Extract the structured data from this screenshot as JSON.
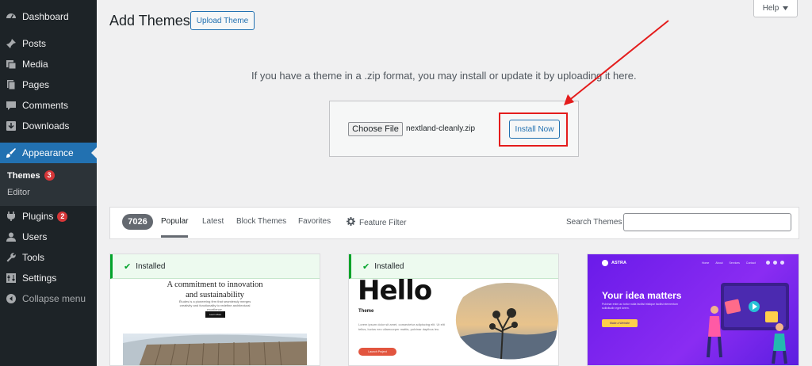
{
  "sidebar": {
    "items": [
      {
        "label": "Dashboard",
        "icon": "dashboard-icon"
      },
      {
        "label": "Posts",
        "icon": "pin-icon"
      },
      {
        "label": "Media",
        "icon": "media-icon"
      },
      {
        "label": "Pages",
        "icon": "pages-icon"
      },
      {
        "label": "Comments",
        "icon": "comment-icon"
      },
      {
        "label": "Downloads",
        "icon": "download-icon"
      },
      {
        "label": "Appearance",
        "icon": "brush-icon"
      },
      {
        "label": "Plugins",
        "icon": "plugin-icon",
        "badge": "2"
      },
      {
        "label": "Users",
        "icon": "users-icon"
      },
      {
        "label": "Tools",
        "icon": "wrench-icon"
      },
      {
        "label": "Settings",
        "icon": "settings-icon"
      },
      {
        "label": "Collapse menu",
        "icon": "collapse-icon"
      }
    ],
    "submenu": [
      {
        "label": "Themes",
        "badge": "3"
      },
      {
        "label": "Editor"
      }
    ]
  },
  "header": {
    "title": "Add Themes",
    "upload_label": "Upload Theme",
    "help_label": "Help"
  },
  "upload": {
    "message": "If you have a theme in a .zip format, you may install or update it by uploading it here.",
    "choose_label": "Choose File",
    "file_name": "nextland-cleanly.zip",
    "install_label": "Install Now"
  },
  "filter": {
    "count": "7026",
    "tabs": [
      "Popular",
      "Latest",
      "Block Themes",
      "Favorites"
    ],
    "feature_filter": "Feature Filter",
    "search_label": "Search Themes",
    "search_value": ""
  },
  "themes": [
    {
      "installed": "Installed",
      "heading": "A commitment to innovation\nand sustainability",
      "subtext": "Études is a pioneering firm that seamlessly merges creativity and functionality to redefine architectural excellence.",
      "button": "Learn More"
    },
    {
      "installed": "Installed",
      "heading": "Hello",
      "subheading": "Theme",
      "text": "Lorem ipsum dolor sit amet, consectetur adipiscing elit. Ut elit tellus, luctus nec ullamcorper mattis, pulvinar dapibus leo.",
      "button": "Launch Project"
    },
    {
      "logo": "ASTRA",
      "nav": [
        "Home",
        "About",
        "Services",
        "Contact"
      ],
      "heading": "Your idea matters",
      "text": "Pulvinar enim ac tortor nulla facilisi tristique facilisi elementum sollicitudin eget lorem.",
      "button": "Make a Website"
    }
  ],
  "colors": {
    "sidebar_bg": "#1d2327",
    "accent": "#2271b1",
    "badge": "#d63638",
    "installed_green": "#00a32a",
    "annotation_red": "#e41c1c"
  }
}
